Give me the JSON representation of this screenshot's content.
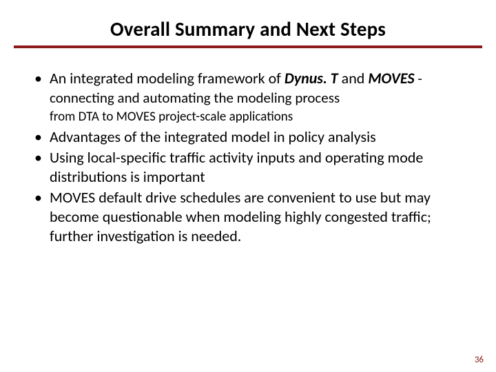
{
  "title": "Overall Summary and Next Steps",
  "bullets": {
    "b1_pre": "An integrated modeling framework of ",
    "b1_bi1": "Dynus. T",
    "b1_mid": " and ",
    "b1_bi2": "MOVES",
    "b1_sub1": "  - connecting and automating the modeling process",
    "b1_sub2": "from DTA to MOVES project-scale applications",
    "b2": "Advantages of the integrated model in policy analysis",
    "b3": "Using local-specific traffic activity inputs and operating mode distributions is important",
    "b4": "MOVES default drive schedules are convenient to use but may become questionable when modeling highly congested traffic; further investigation is needed."
  },
  "page_number": "36"
}
